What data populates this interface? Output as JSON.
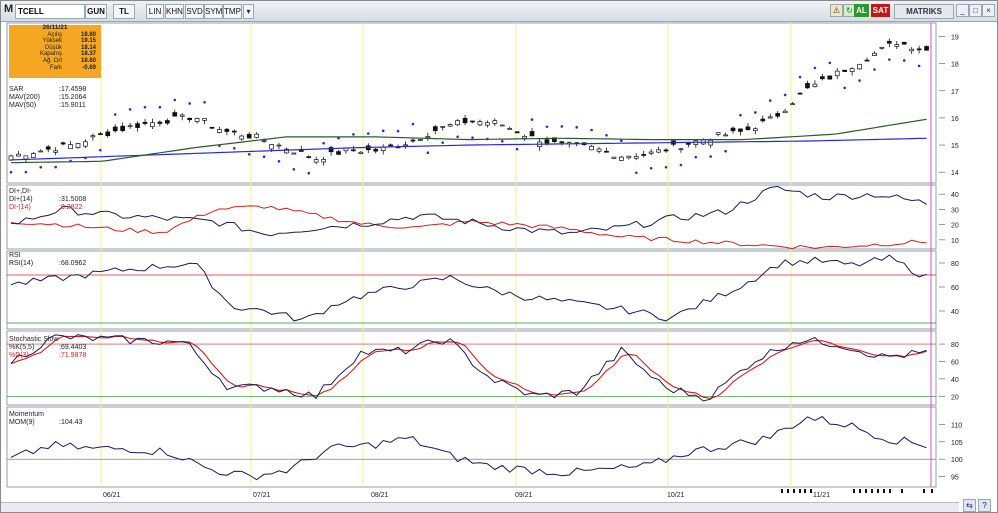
{
  "toolbar": {
    "symbol": "TCELL",
    "period": "GUN",
    "currency": "TL",
    "buttons": [
      "LIN",
      "KHN",
      "SVD",
      "SYM",
      "TMP"
    ],
    "buy": "AL",
    "sell": "SAT",
    "brand": "MATRIKS"
  },
  "quote": {
    "date": "26/11/21",
    "rows": [
      {
        "label": "Açılış",
        "value": "18.80"
      },
      {
        "label": "Yüksek",
        "value": "19.15"
      },
      {
        "label": "Düşük",
        "value": "18.14"
      },
      {
        "label": "Kapanış",
        "value": "18.37"
      },
      {
        "label": "Ağ. Ort",
        "value": "18.60"
      },
      {
        "label": "Fark",
        "value": "-0.69"
      }
    ]
  },
  "price_legend": [
    {
      "name": "SAR",
      "value": ":17.4598",
      "color": "#2a2ad0"
    },
    {
      "name": "MAV(200)",
      "value": ":15.2064",
      "color": "#2a2ad0"
    },
    {
      "name": "MAV(50)",
      "value": ":15.9011",
      "color": "#333"
    }
  ],
  "dmi": {
    "title": "DI+,DI-",
    "legend": [
      {
        "name": "DI+(14)",
        "value": ":31.5008",
        "color": "#1a1a5a"
      },
      {
        "name": "DI-(14)",
        "value": ":9.2822",
        "color": "#d02020"
      }
    ]
  },
  "rsi": {
    "title": "RSI",
    "legend": [
      {
        "name": "RSI(14)",
        "value": ":68.0962",
        "color": "#1a1a5a"
      }
    ]
  },
  "stoch": {
    "title": "Stochastic Slow",
    "legend": [
      {
        "name": "%K(5,5)",
        "value": ":69.4403",
        "color": "#1a1a5a"
      },
      {
        "name": "%D(3)",
        "value": ":71.9878",
        "color": "#d02020"
      }
    ]
  },
  "mom": {
    "title": "Momentum",
    "legend": [
      {
        "name": "MOM(9)",
        "value": ":104.43",
        "color": "#1a1a5a"
      }
    ]
  },
  "axes": {
    "price_ticks": [
      "19",
      "18",
      "17",
      "16",
      "15",
      "14"
    ],
    "dmi_ticks": [
      "40",
      "30",
      "20",
      "10"
    ],
    "rsi_ticks": [
      "80",
      "60",
      "40"
    ],
    "stoch_ticks": [
      "80",
      "60",
      "40",
      "20"
    ],
    "mom_ticks": [
      "110",
      "105",
      "100",
      "95"
    ],
    "months": [
      "06/21",
      "07/21",
      "08/21",
      "09/21",
      "10/21",
      "11/21"
    ]
  }
}
